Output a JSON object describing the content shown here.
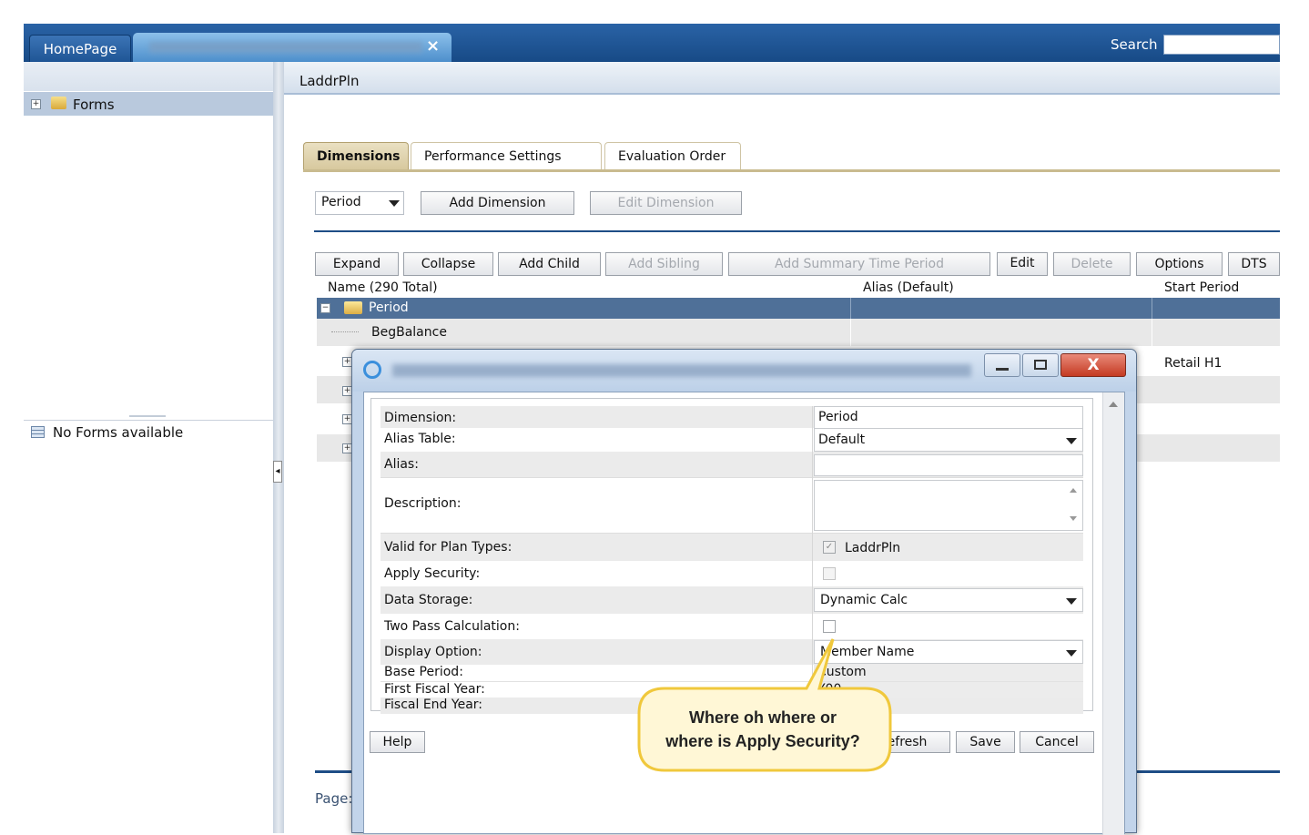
{
  "top_bar": {
    "home_tab": "HomePage",
    "open_tab_close": "×",
    "search_label": "Search",
    "search_value": ""
  },
  "left_panel": {
    "forms_label": "Forms",
    "no_forms": "No Forms available",
    "collapse_handle": "◂"
  },
  "main": {
    "title": "LaddrPln",
    "tabs": [
      "Dimensions",
      "Performance Settings",
      "Evaluation Order"
    ],
    "dimension_select": "Period",
    "add_dimension": "Add Dimension",
    "edit_dimension": "Edit Dimension",
    "toolbar": {
      "expand": "Expand",
      "collapse": "Collapse",
      "add_child": "Add Child",
      "add_sibling": "Add Sibling",
      "add_summary": "Add Summary Time Period",
      "edit": "Edit",
      "delete": "Delete",
      "options": "Options",
      "dts": "DTS"
    },
    "grid": {
      "col_name": "Name  (290 Total)",
      "col_alias": "Alias   (Default)",
      "col_start": "Start Period",
      "row_period": "Period",
      "row_begbalance": "BegBalance",
      "row_retail": "Retail H1"
    },
    "page_label": "Page:"
  },
  "dialog": {
    "close_glyph": "X",
    "fields": {
      "dimension_label": "Dimension:",
      "dimension_value": "Period",
      "alias_table_label": "Alias Table:",
      "alias_table_value": "Default",
      "alias_label": "Alias:",
      "description_label": "Description:",
      "valid_plan_label": "Valid for Plan Types:",
      "valid_plan_value": "LaddrPln",
      "apply_security_label": "Apply Security:",
      "data_storage_label": "Data Storage:",
      "data_storage_value": "Dynamic Calc",
      "two_pass_label": "Two Pass Calculation:",
      "display_option_label": "Display Option:",
      "display_option_value": "Member Name",
      "base_period_label": "Base Period:",
      "base_period_value": "Custom",
      "first_fiscal_label": "First Fiscal Year:",
      "first_fiscal_value": "Y00",
      "fiscal_end_label": "Fiscal End Year:"
    },
    "buttons": {
      "help": "Help",
      "refresh": "Refresh",
      "save": "Save",
      "cancel": "Cancel"
    }
  },
  "callout": {
    "line1": "Where oh where or",
    "line2": "where is Apply Security?"
  },
  "colors": {
    "header_blue": "#1a4f8a",
    "selected_row": "#4f7098",
    "panel_blue": "#b9c9dd",
    "callout_fill": "#fff7d6",
    "callout_border": "#f0c83c"
  }
}
